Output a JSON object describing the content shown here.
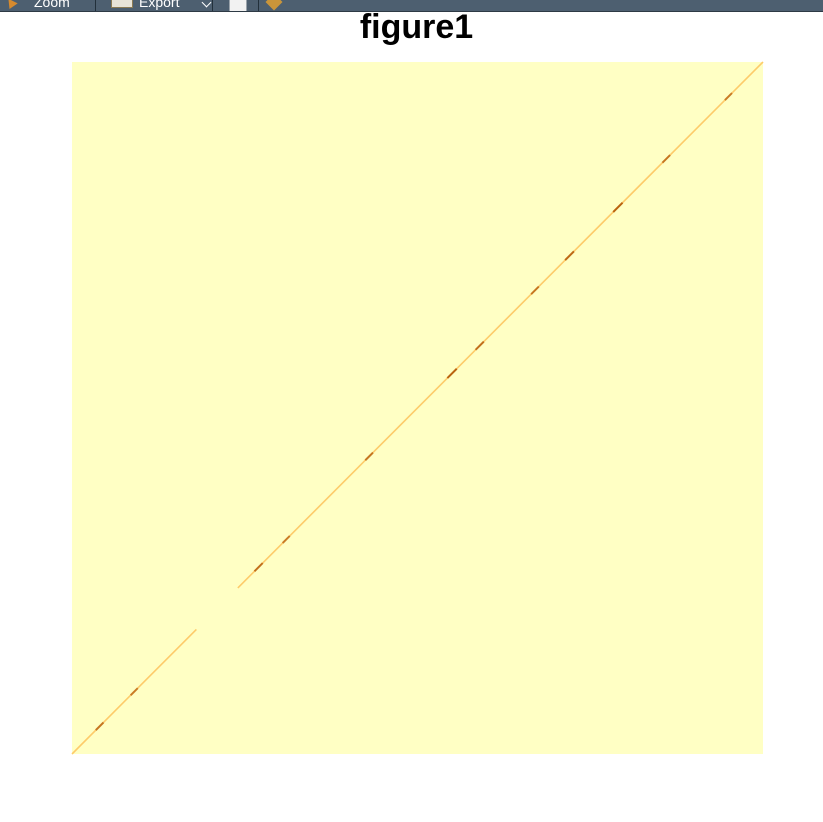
{
  "toolbar": {
    "zoom_label": "Zoom",
    "export_label": "Export",
    "icons": [
      "zoom-icon",
      "export-icon",
      "page-icon",
      "brush-icon"
    ]
  },
  "colors": {
    "toolbar_bg": "#4d5f70",
    "heatmap_low": "#ffffc4",
    "heatmap_mid": "#fdcb6a",
    "heatmap_high": "#b35806"
  },
  "chart_data": {
    "type": "heatmap",
    "title": "figure1",
    "xlabel": "",
    "ylabel": "",
    "axes_visible": false,
    "grid": false,
    "legend": "none",
    "colormap": "YlOrBr",
    "background_value": 0,
    "pattern": "diagonal",
    "diagonal_segments": [
      {
        "from": [
          0.0,
          0.0
        ],
        "to": [
          0.18,
          0.18
        ]
      },
      {
        "from": [
          0.24,
          0.24
        ],
        "to": [
          1.0,
          1.0
        ]
      }
    ],
    "diagonal_hotspots": [
      {
        "pos": 0.04,
        "intensity": 0.6
      },
      {
        "pos": 0.09,
        "intensity": 0.5
      },
      {
        "pos": 0.27,
        "intensity": 0.7
      },
      {
        "pos": 0.31,
        "intensity": 0.5
      },
      {
        "pos": 0.43,
        "intensity": 0.6
      },
      {
        "pos": 0.55,
        "intensity": 0.9
      },
      {
        "pos": 0.59,
        "intensity": 0.7
      },
      {
        "pos": 0.67,
        "intensity": 0.6
      },
      {
        "pos": 0.72,
        "intensity": 0.8
      },
      {
        "pos": 0.79,
        "intensity": 0.9
      },
      {
        "pos": 0.86,
        "intensity": 0.6
      },
      {
        "pos": 0.95,
        "intensity": 0.5
      }
    ]
  }
}
